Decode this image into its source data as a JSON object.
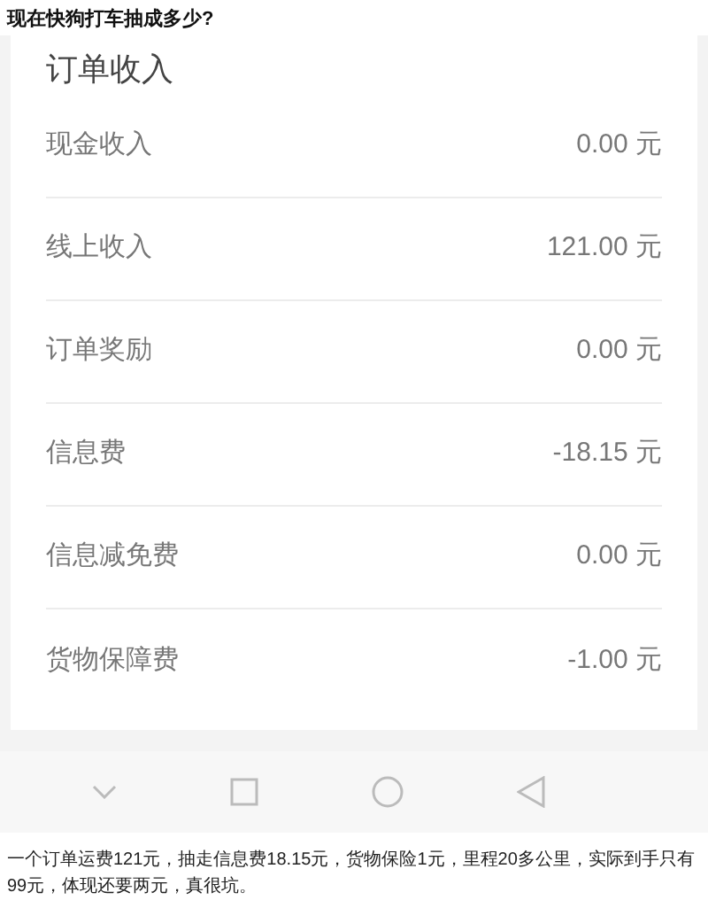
{
  "question_title": "现在快狗打车抽成多少?",
  "screenshot": {
    "section_title": "订单收入",
    "rows": [
      {
        "label": "现金收入",
        "amount": "0.00 元"
      },
      {
        "label": "线上收入",
        "amount": "121.00 元"
      },
      {
        "label": "订单奖励",
        "amount": "0.00 元"
      },
      {
        "label": "信息费",
        "amount": "-18.15 元"
      },
      {
        "label": "信息减免费",
        "amount": "0.00 元"
      },
      {
        "label": "货物保障费",
        "amount": "-1.00 元"
      }
    ]
  },
  "caption": "一个订单运费121元，抽走信息费18.15元，货物保险1元，里程20多公里，实际到手只有99元，体现还要两元，真很坑。"
}
